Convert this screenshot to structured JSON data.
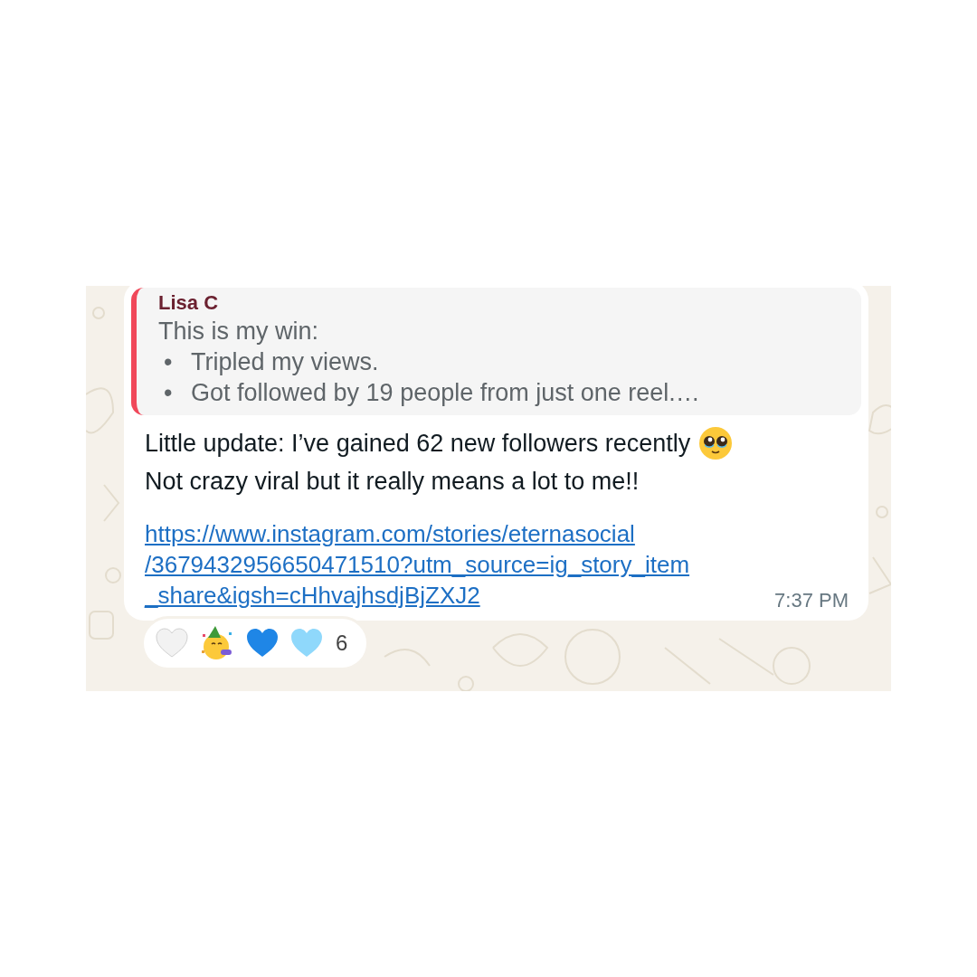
{
  "message": {
    "quoted": {
      "sender": "Lisa C",
      "intro": "This is my win:",
      "bullet": "•",
      "items": [
        "Tripled my views.",
        "Got followed by 19 people from just one reel.…"
      ]
    },
    "lines": [
      {
        "text": "Little update: I’ve gained 62 new followers recently",
        "emoji": {
          "kind": "pleading_face"
        }
      },
      {
        "text": "Not crazy viral but it really means a lot to me!!"
      }
    ],
    "link_lines": [
      "https://www.instagram.com/stories/eternasocial",
      "/3679432956650471510?utm_source=ig_story_item",
      "_share&igsh=cHhvajhsdjBjZXJ2"
    ],
    "time": "7:37 PM"
  },
  "reactions": {
    "items": [
      {
        "kind": "white_heart"
      },
      {
        "kind": "party_face"
      },
      {
        "kind": "blue_heart"
      },
      {
        "kind": "light_blue_heart"
      }
    ],
    "count": "6"
  }
}
